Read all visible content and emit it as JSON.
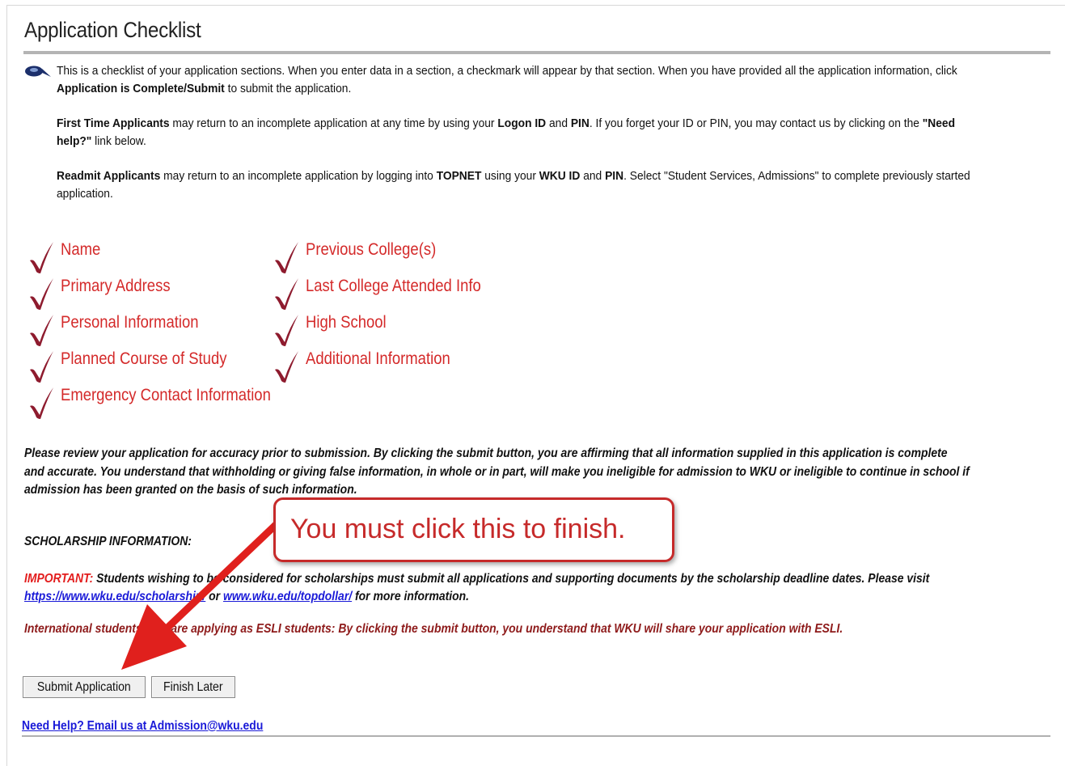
{
  "title": "Application Checklist",
  "intro": {
    "p1_a": "This is a checklist of your application sections. When you enter data in a section, a checkmark will appear by that section. When you have provided all the application information, click ",
    "p1_b": "Application is Complete/Submit",
    "p1_c": " to submit the application.",
    "p2_a": "First Time Applicants",
    "p2_b": " may return to an incomplete application at any time by using your ",
    "p2_c": "Logon ID",
    "p2_d": " and ",
    "p2_e": "PIN",
    "p2_f": ". If you forget your ID or PIN, you may contact us by clicking on the ",
    "p2_g": "\"Need help?\"",
    "p2_h": " link below.",
    "p3_a": "Readmit Applicants",
    "p3_b": " may return to an incomplete application by logging into ",
    "p3_c": "TOPNET",
    "p3_d": " using your ",
    "p3_e": "WKU ID",
    "p3_f": " and ",
    "p3_g": "PIN",
    "p3_h": ". Select \"Student Services, Admissions\" to complete previously started application."
  },
  "checklist": {
    "left": [
      "Name",
      "Primary Address",
      "Personal Information",
      "Planned Course of Study",
      "Emergency Contact Information"
    ],
    "right": [
      "Previous College(s)",
      "Last College Attended Info",
      "High School",
      "Additional Information"
    ]
  },
  "affirmation": "Please review your application for accuracy prior to submission. By clicking the submit button, you are affirming that all information supplied in this application is complete and accurate. You understand that withholding or giving false information, in whole or in part, will make you ineligible for admission to WKU or ineligible to continue in school if admission has been granted on the basis of such information.",
  "scholarship": {
    "heading": "SCHOLARSHIP INFORMATION:",
    "important_label": "IMPORTANT:",
    "important_text": " Students wishing to be considered for scholarships must submit all applications and supporting documents by the scholarship deadline dates. Please visit ",
    "link1": "https://www.wku.edu/scholarship/",
    "or": " or ",
    "link2": "www.wku.edu/topdollar/",
    "tail": " for more information."
  },
  "international": "International students who are applying as ESLI students: By clicking the submit button, you understand that WKU will share your application with ESLI.",
  "buttons": {
    "submit": "Submit Application",
    "later": "Finish Later"
  },
  "help_link": "Need Help? Email us at Admission@wku.edu",
  "callout": "You must click this to finish.",
  "colors": {
    "check": "#8e1b2e",
    "item_text": "#d42a2a",
    "callout": "#c62a2a",
    "arrow": "#e0201d",
    "link": "#1a1ad8"
  }
}
